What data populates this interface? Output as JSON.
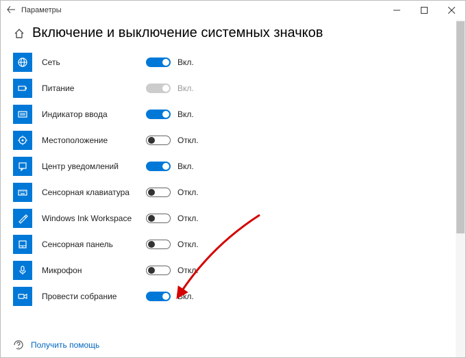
{
  "window": {
    "title": "Параметры",
    "page_title": "Включение и выключение системных значков"
  },
  "states": {
    "on": "Вкл.",
    "off": "Откл.",
    "disabled": "Вкл."
  },
  "items": [
    {
      "key": "network",
      "label": "Сеть",
      "value": "on",
      "icon": "globe-icon"
    },
    {
      "key": "power",
      "label": "Питание",
      "value": "disabled",
      "icon": "battery-icon"
    },
    {
      "key": "ime",
      "label": "Индикатор ввода",
      "value": "on",
      "icon": "keyboard-layout-icon"
    },
    {
      "key": "location",
      "label": "Местоположение",
      "value": "off",
      "icon": "location-icon"
    },
    {
      "key": "action",
      "label": "Центр уведомлений",
      "value": "on",
      "icon": "action-center-icon"
    },
    {
      "key": "touchkb",
      "label": "Сенсорная клавиатура",
      "value": "off",
      "icon": "touch-keyboard-icon"
    },
    {
      "key": "ink",
      "label": "Windows Ink Workspace",
      "value": "off",
      "icon": "ink-icon"
    },
    {
      "key": "touchpad",
      "label": "Сенсорная панель",
      "value": "off",
      "icon": "touchpad-icon"
    },
    {
      "key": "mic",
      "label": "Микрофон",
      "value": "off",
      "icon": "microphone-icon"
    },
    {
      "key": "meetnow",
      "label": "Провести собрание",
      "value": "on",
      "icon": "meet-now-icon"
    }
  ],
  "footer": {
    "help_label": "Получить помощь"
  }
}
